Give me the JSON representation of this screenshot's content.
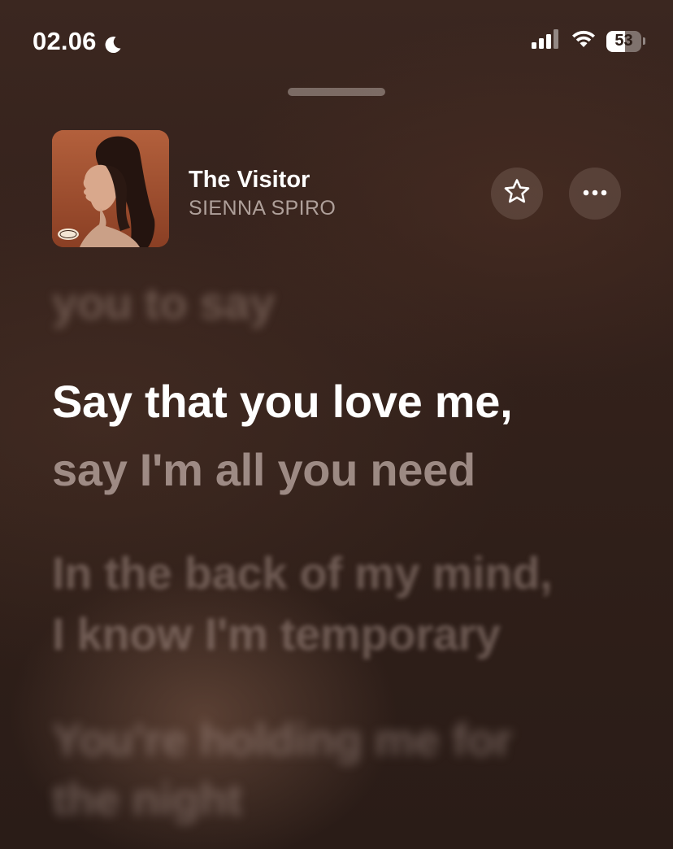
{
  "status_bar": {
    "time": "02.06",
    "focus_icon": "moon-icon",
    "signal_icon": "cellular-signal-icon",
    "wifi_icon": "wifi-icon",
    "battery_level": "53",
    "battery_fraction": 0.53
  },
  "sheet": {
    "grabber_icon": "grabber-handle"
  },
  "now_playing": {
    "title": "The Visitor",
    "artist": "SIENNA SPIRO",
    "artwork_icon": "album-artwork",
    "favorite_icon": "star-icon",
    "more_icon": "ellipsis-icon"
  },
  "lyrics": {
    "previous": "you to say",
    "current": "Say that you love me,",
    "current_continued": "say I'm all you need",
    "upcoming": [
      "In the back of my mind,",
      "I know I'm temporary",
      "You're holding me for",
      "the night"
    ]
  },
  "colors": {
    "background": "#35221c",
    "active_lyric": "#ffffff",
    "inactive_lyric": "#b6a49d"
  }
}
